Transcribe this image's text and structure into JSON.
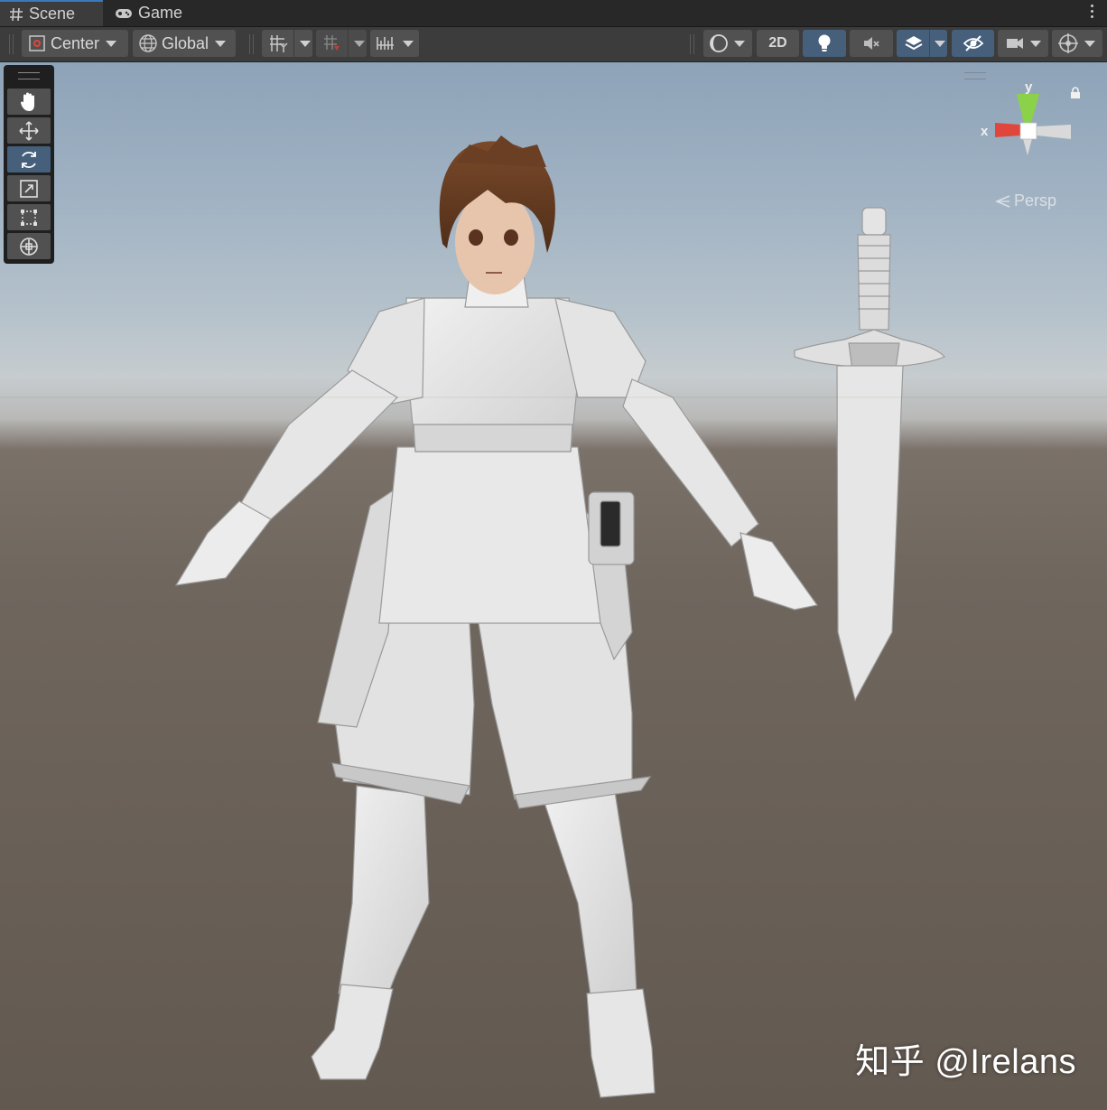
{
  "tabs": [
    {
      "label": "Scene",
      "icon": "hash-grid-icon",
      "active": true
    },
    {
      "label": "Game",
      "icon": "gamepad-icon",
      "active": false
    }
  ],
  "toolbar": {
    "pivot_label": "Center",
    "space_label": "Global",
    "mode_2d_label": "2D"
  },
  "tools": [
    {
      "name": "hand-tool",
      "icon": "hand-icon",
      "active": false
    },
    {
      "name": "move-tool",
      "icon": "move-arrows-icon",
      "active": false
    },
    {
      "name": "rotate-tool",
      "icon": "rotate-icon",
      "active": true
    },
    {
      "name": "scale-tool",
      "icon": "scale-icon",
      "active": false
    },
    {
      "name": "rect-tool",
      "icon": "rect-transform-icon",
      "active": false
    },
    {
      "name": "transform-tool",
      "icon": "transform-icon",
      "active": false
    }
  ],
  "gizmo": {
    "y_label": "y",
    "x_label": "x",
    "projection_label": "Persp",
    "colors": {
      "y": "#8bd24a",
      "x": "#e0463b",
      "neutral": "#e6e6e6"
    }
  },
  "watermark": "知乎 @Irelans",
  "colors": {
    "active_blue": "#46607c",
    "tab_accent": "#3a79bb",
    "toolbar_bg": "#3c3c3c",
    "button_bg": "#515151"
  }
}
